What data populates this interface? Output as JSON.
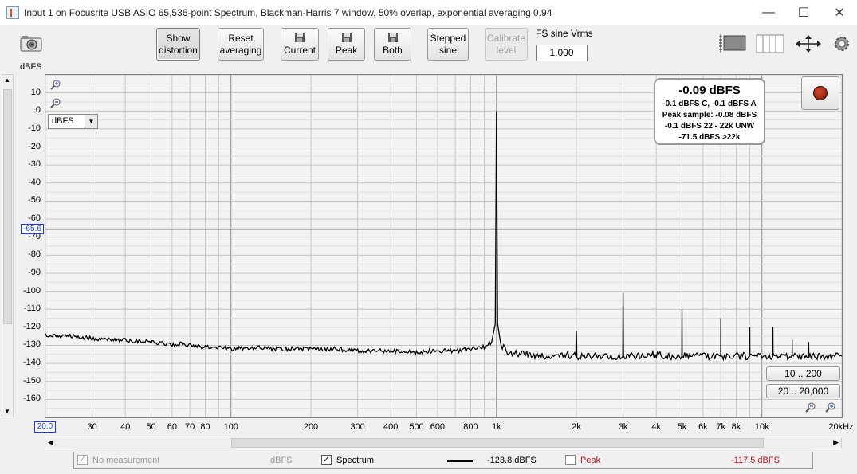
{
  "window": {
    "title": "Input 1 on Focusrite USB ASIO 65,536-point Spectrum, Blackman-Harris 7 window, 50% overlap, exponential averaging 0.94",
    "minimize": "—",
    "maximize": "☐",
    "close": "✕"
  },
  "toolbar": {
    "show_distortion": [
      "Show",
      "distortion"
    ],
    "reset_averaging": [
      "Reset",
      "averaging"
    ],
    "current": "Current",
    "peak": "Peak",
    "both": "Both",
    "stepped_sine": [
      "Stepped",
      "sine"
    ],
    "calibrate_level": [
      "Calibrate",
      "level"
    ],
    "fs_label": "FS sine Vrms",
    "fs_value": "1.000"
  },
  "plot": {
    "y_unit": "dBFS",
    "unit_dropdown": "dBFS",
    "cursor_value": "-65.6",
    "x_start": "20.0",
    "x_end_label": "20kHz"
  },
  "readout": {
    "main": "-0.09 dBFS",
    "line1": "-0.1 dBFS C, -0.1 dBFS A",
    "line2": "Peak sample: -0.08 dBFS",
    "line3": "-0.1 dBFS 22 - 22k UNW",
    "line4": "-71.5 dBFS >22k"
  },
  "range_buttons": {
    "r1": "10 .. 200",
    "r2": "20 .. 20,000"
  },
  "legend": {
    "no_measurement": "No measurement",
    "no_measurement_unit": "dBFS",
    "spectrum": "Spectrum",
    "spectrum_value": "-123.8 dBFS",
    "peak": "Peak",
    "peak_value": "-117.5 dBFS",
    "peak_color": "#c0141c"
  },
  "chart_data": {
    "type": "line",
    "title": "",
    "xlabel": "",
    "ylabel": "dBFS",
    "xscale": "log",
    "xlim": [
      20,
      20000
    ],
    "ylim": [
      -170,
      20
    ],
    "cursor_y": -65.6,
    "yticks": [
      10,
      0,
      -10,
      -20,
      -30,
      -40,
      -50,
      -60,
      -70,
      -80,
      -90,
      -100,
      -110,
      -120,
      -130,
      -140,
      -150,
      -160
    ],
    "xticks": [
      {
        "v": 30,
        "t": "30"
      },
      {
        "v": 40,
        "t": "40"
      },
      {
        "v": 50,
        "t": "50"
      },
      {
        "v": 60,
        "t": "60"
      },
      {
        "v": 70,
        "t": "70"
      },
      {
        "v": 80,
        "t": "80"
      },
      {
        "v": 100,
        "t": "100"
      },
      {
        "v": 200,
        "t": "200"
      },
      {
        "v": 300,
        "t": "300"
      },
      {
        "v": 400,
        "t": "400"
      },
      {
        "v": 500,
        "t": "500"
      },
      {
        "v": 600,
        "t": "600"
      },
      {
        "v": 800,
        "t": "800"
      },
      {
        "v": 1000,
        "t": "1k"
      },
      {
        "v": 2000,
        "t": "2k"
      },
      {
        "v": 3000,
        "t": "3k"
      },
      {
        "v": 4000,
        "t": "4k"
      },
      {
        "v": 5000,
        "t": "5k"
      },
      {
        "v": 6000,
        "t": "6k"
      },
      {
        "v": 7000,
        "t": "7k"
      },
      {
        "v": 8000,
        "t": "8k"
      },
      {
        "v": 10000,
        "t": "10k"
      }
    ],
    "series": [
      {
        "color": "#000000",
        "x": [
          20,
          25,
          30,
          35,
          40,
          45,
          50,
          55,
          60,
          65,
          70,
          80,
          90,
          100,
          120,
          150,
          200,
          250,
          300,
          400,
          500,
          600,
          700,
          800,
          900,
          960,
          990,
          1000,
          1010,
          1040,
          1100,
          1300,
          1500,
          1800,
          1990,
          2000,
          2010,
          2300,
          2700,
          2990,
          3000,
          3010,
          3500,
          4000,
          4500,
          4990,
          5000,
          5010,
          6000,
          6990,
          7000,
          7010,
          8000,
          8990,
          9000,
          9010,
          10000,
          10990,
          11000,
          11010,
          12500,
          12990,
          13000,
          13010,
          14500,
          14990,
          15000,
          15010,
          17000,
          20000
        ],
        "y": [
          -124,
          -125,
          -126,
          -127,
          -127,
          -128,
          -128,
          -129,
          -130,
          -129,
          -130,
          -131,
          -131,
          -132,
          -131,
          -132,
          -132,
          -132,
          -133,
          -133,
          -134,
          -133,
          -133,
          -132,
          -131,
          -128,
          -118,
          -0.1,
          -118,
          -130,
          -134,
          -135,
          -136,
          -135,
          -136,
          -122,
          -136,
          -136,
          -136,
          -136,
          -101,
          -136,
          -136,
          -135,
          -136,
          -136,
          -110,
          -136,
          -136,
          -136,
          -115,
          -136,
          -136,
          -136,
          -120,
          -136,
          -136,
          -136,
          -120,
          -136,
          -136,
          -136,
          -126,
          -136,
          -136,
          -136,
          -130,
          -136,
          -136,
          -136
        ]
      }
    ]
  }
}
